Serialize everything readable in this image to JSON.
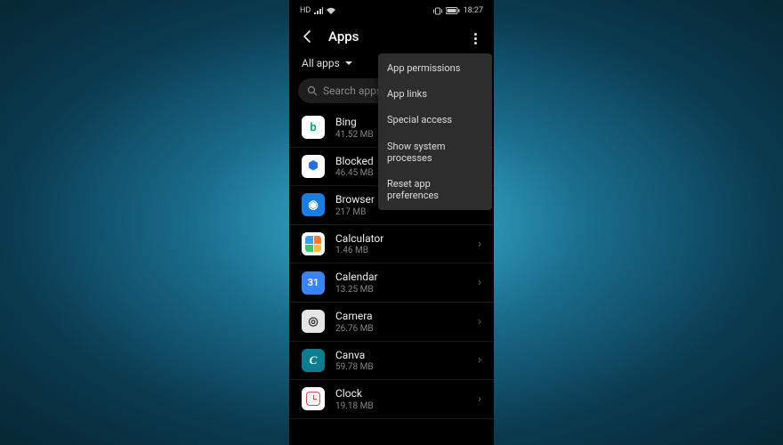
{
  "status": {
    "hd": "HD",
    "time": "18:27"
  },
  "header": {
    "title": "Apps"
  },
  "filter": {
    "label": "All apps"
  },
  "search": {
    "placeholder": "Search apps"
  },
  "menu": {
    "items": [
      {
        "label": "App permissions"
      },
      {
        "label": "App links"
      },
      {
        "label": "Special access"
      },
      {
        "label": "Show system processes"
      },
      {
        "label": "Reset app preferences"
      }
    ]
  },
  "apps": [
    {
      "name": "Bing",
      "size": "41.52 MB",
      "icon": "bing",
      "letter": "b"
    },
    {
      "name": "Blocked",
      "size": "46.45 MB",
      "icon": "blocked",
      "letter": "⬢"
    },
    {
      "name": "Browser",
      "size": "217 MB",
      "icon": "browser",
      "letter": "◉"
    },
    {
      "name": "Calculator",
      "size": "1.46 MB",
      "icon": "calculator",
      "letter": ""
    },
    {
      "name": "Calendar",
      "size": "13.25 MB",
      "icon": "calendar",
      "letter": "31"
    },
    {
      "name": "Camera",
      "size": "26.76 MB",
      "icon": "camera",
      "letter": "◎"
    },
    {
      "name": "Canva",
      "size": "59.78 MB",
      "icon": "canva",
      "letter": "C"
    },
    {
      "name": "Clock",
      "size": "19.18 MB",
      "icon": "clock",
      "letter": ""
    }
  ]
}
